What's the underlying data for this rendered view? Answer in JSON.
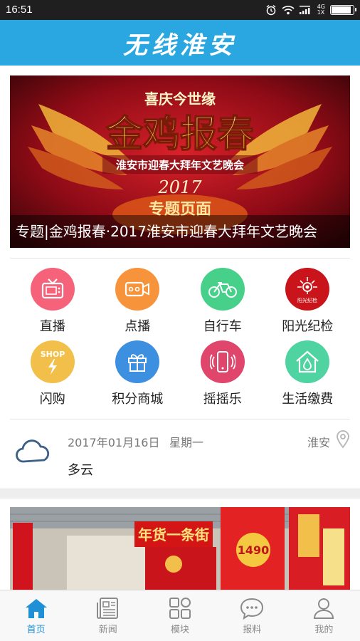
{
  "status_bar": {
    "time": "16:51",
    "network_type": "4G",
    "network_sub": "1X",
    "icons": [
      "alarm-icon",
      "wifi-icon",
      "signal-icon",
      "battery-icon"
    ],
    "battery_level": 0.85
  },
  "header": {
    "title": "无线淮安",
    "color": "#2aa7e0"
  },
  "banner": {
    "art_badge": "喜庆今世缘",
    "art_title": "金鸡报春",
    "art_subtitle": "淮安市迎春大拜年文艺晚会",
    "art_year": "2017",
    "art_tag": "专题页面",
    "caption": "专题|金鸡报春·2017淮安市迎春大拜年文艺晚会"
  },
  "quick_grid": [
    {
      "label": "直播",
      "icon": "tv-icon",
      "color": "#f5627a"
    },
    {
      "label": "点播",
      "icon": "video-camera-icon",
      "color": "#f7943b"
    },
    {
      "label": "自行车",
      "icon": "bicycle-icon",
      "color": "#46d08a"
    },
    {
      "label": "阳光纪检",
      "icon": "sunshine-logo-icon",
      "color": "#c8141a",
      "logo_text": "阳光纪检"
    },
    {
      "label": "闪购",
      "icon": "shop-flash-icon",
      "color": "#f2c04a",
      "logo_text": "SHOP"
    },
    {
      "label": "积分商城",
      "icon": "gift-icon",
      "color": "#3d8fe0"
    },
    {
      "label": "摇摇乐",
      "icon": "shake-phone-icon",
      "color": "#e0456b"
    },
    {
      "label": "生活缴费",
      "icon": "house-drop-icon",
      "color": "#4fd3a0"
    }
  ],
  "weather": {
    "date": "2017年01月16日",
    "weekday": "星期一",
    "city": "淮安",
    "condition": "多云",
    "icon": "cloud-icon"
  },
  "news_image": {
    "sign_text": "年货一条街",
    "price_tag": "1490"
  },
  "tab_bar": {
    "active_color": "#1f8fd6",
    "tabs": [
      {
        "label": "首页",
        "icon": "home-icon",
        "active": true
      },
      {
        "label": "新闻",
        "icon": "newspaper-icon",
        "active": false
      },
      {
        "label": "模块",
        "icon": "grid-icon",
        "active": false
      },
      {
        "label": "报料",
        "icon": "chat-bubble-icon",
        "active": false
      },
      {
        "label": "我的",
        "icon": "user-icon",
        "active": false
      }
    ]
  }
}
